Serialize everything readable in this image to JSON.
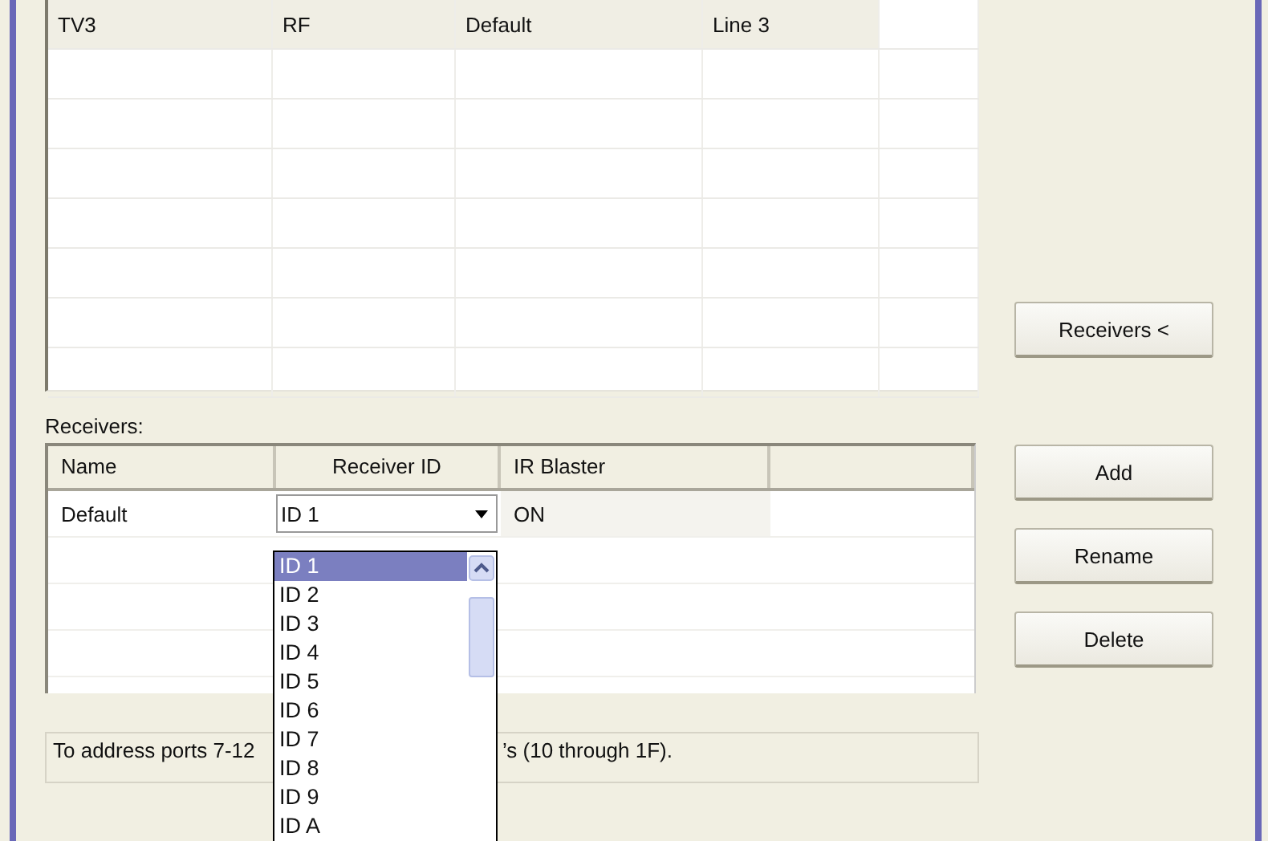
{
  "top_table": {
    "rows": [
      {
        "cells": [
          "TV3",
          "RF",
          "Default",
          "Line 3"
        ],
        "selected": true
      }
    ]
  },
  "receivers": {
    "label": "Receivers:",
    "columns": [
      "Name",
      "Receiver ID",
      "IR Blaster"
    ],
    "rows": [
      {
        "name": "Default",
        "receiver_id": "ID 1",
        "ir_blaster": "ON"
      }
    ],
    "dropdown": {
      "items": [
        {
          "label": "ID 1",
          "selected": true
        },
        {
          "label": "ID 2",
          "selected": false
        },
        {
          "label": "ID 3",
          "selected": false
        },
        {
          "label": "ID 4",
          "selected": false
        },
        {
          "label": "ID 5",
          "selected": false
        },
        {
          "label": "ID 6",
          "selected": false
        },
        {
          "label": "ID 7",
          "selected": false
        },
        {
          "label": "ID 8",
          "selected": false
        },
        {
          "label": "ID 9",
          "selected": false
        },
        {
          "label": "ID A",
          "selected": false
        }
      ]
    }
  },
  "message": {
    "visible_parts": [
      "To address ports 7-12",
      "’s (10 through 1F)."
    ]
  },
  "buttons": {
    "toggle": "Receivers <",
    "actions": [
      "Add",
      "Rename",
      "Delete"
    ]
  }
}
